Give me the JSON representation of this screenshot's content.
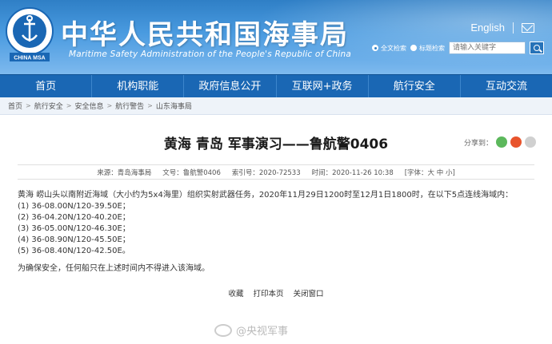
{
  "header": {
    "title_cn": "中华人民共和国海事局",
    "title_en": "Maritime Safety Administration of the People's Republic of China",
    "logo_text_top": "中华人民共和国海事",
    "logo_text_bottom": "CHINA MSA",
    "lang_link": "English",
    "mail_icon": "mail-icon",
    "search": {
      "options": [
        "全文检索",
        "标题检索"
      ],
      "selected": "全文检索",
      "placeholder": "请输入关键字",
      "button_icon": "search-icon"
    },
    "colors": {
      "header_blue": "#2f7fc6",
      "nav_blue": "#1a67b4"
    }
  },
  "nav": {
    "items": [
      "首页",
      "机构职能",
      "政府信息公开",
      "互联网+政务",
      "航行安全",
      "互动交流"
    ]
  },
  "breadcrumb": [
    "首页",
    "航行安全",
    "安全信息",
    "航行警告",
    "山东海事局"
  ],
  "article": {
    "title": "黄海 青岛 军事演习——鲁航警0406",
    "share_label": "分享到：",
    "meta": {
      "source": "来源：青岛海事局",
      "doc_no": "文号：鲁航警0406",
      "index_no": "索引号：2020-72533",
      "time": "时间：2020-11-26 10:38",
      "font": "[字体：大 中 小]"
    },
    "body_intro": "黄海  崂山头以南附近海域（大小约为5x4海里）组织实射武器任务，2020年11月29日1200时至12月1日1800时，在以下5点连线海域内：",
    "points": [
      "(1) 36-08.00N/120-39.50E；",
      "(2) 36-04.20N/120-40.20E；",
      "(3) 36-05.00N/120-46.30E；",
      "(4) 36-08.90N/120-45.50E；",
      "(5) 36-08.40N/120-42.50E。"
    ],
    "notice": "为确保安全，任何船只在上述时间内不得进入该海域。",
    "actions": [
      "收藏",
      "打印本页",
      "关闭窗口"
    ]
  },
  "watermark": "@央视军事"
}
